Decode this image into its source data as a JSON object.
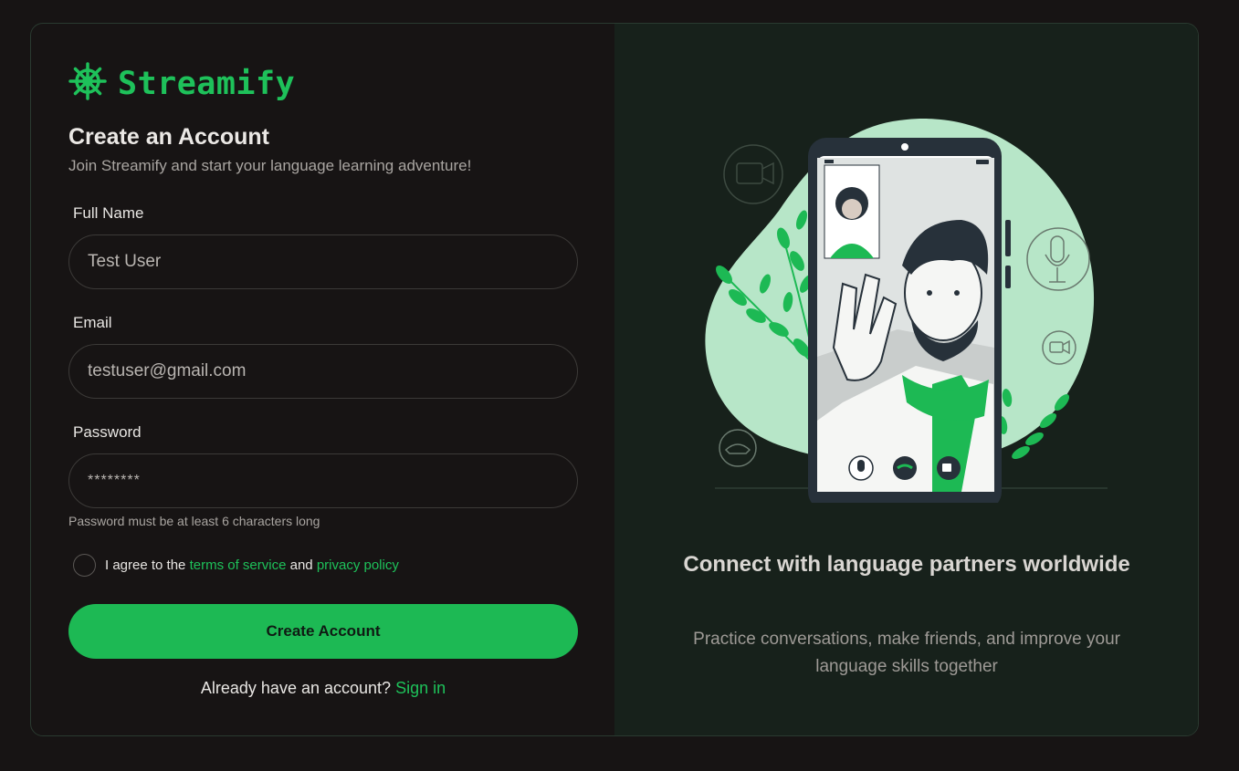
{
  "app": {
    "name": "Streamify",
    "logo_icon": "ship-wheel-icon"
  },
  "form": {
    "title": "Create an Account",
    "subtitle": "Join Streamify and start your language learning adventure!",
    "full_name": {
      "label": "Full Name",
      "value": "Test User"
    },
    "email": {
      "label": "Email",
      "value": "testuser@gmail.com"
    },
    "password": {
      "label": "Password",
      "value": "********",
      "hint": "Password must be at least 6 characters long"
    },
    "agree": {
      "prefix": "I agree to the",
      "terms": "terms of service",
      "and": "and",
      "privacy": "privacy policy",
      "checked": false
    },
    "submit_label": "Create Account",
    "signin_prompt": "Already have an account?",
    "signin_link": "Sign in"
  },
  "promo": {
    "title": "Connect with language partners worldwide",
    "subtitle": "Practice conversations, make friends, and improve your language skills together"
  },
  "colors": {
    "accent": "#1db954",
    "background": "#171414",
    "panel": "#17211b"
  }
}
